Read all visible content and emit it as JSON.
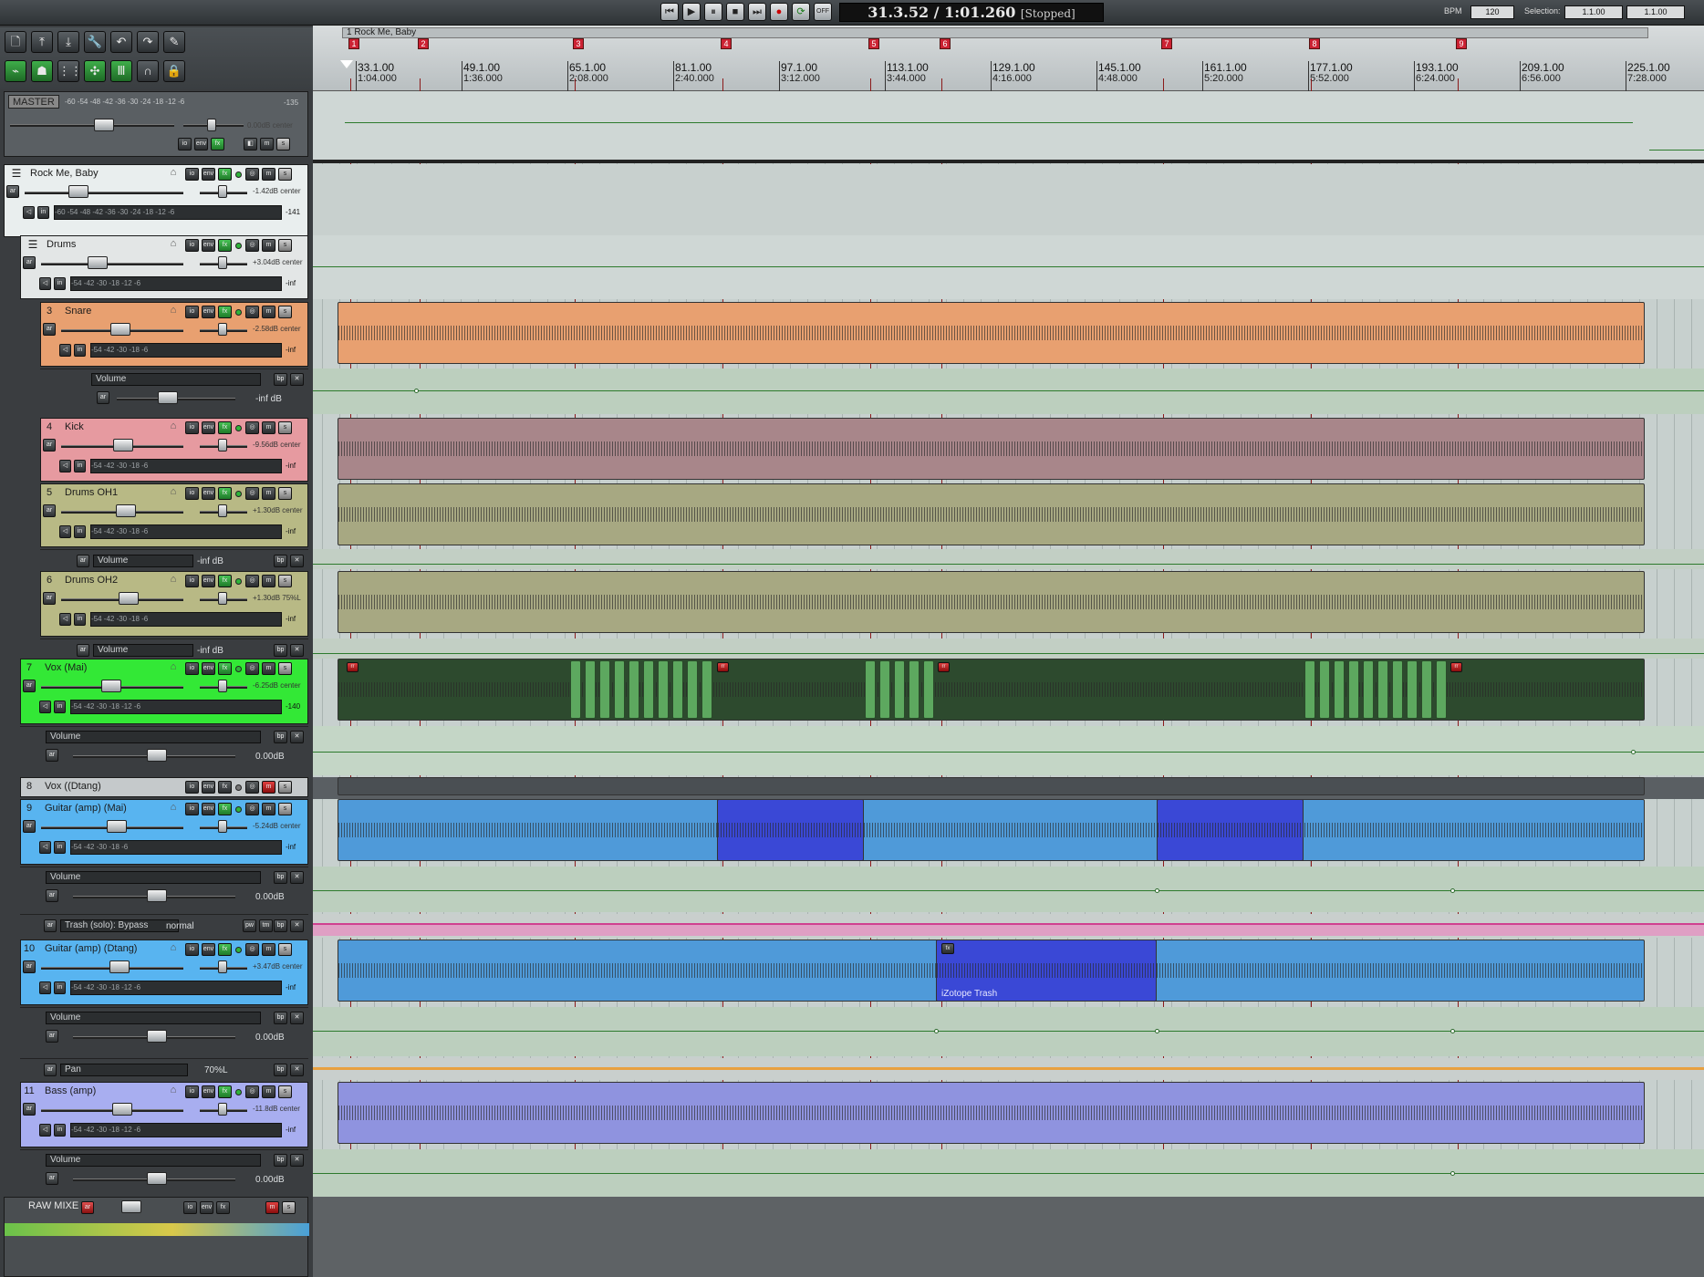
{
  "transport": {
    "time": "31.3.52 / 1:01.260",
    "state": "[Stopped]",
    "off_label": "OFF",
    "bpm_label": "BPM",
    "bpm_value": "120",
    "selection_label": "Selection:",
    "selection_start": "1.1.00",
    "selection_end": "1.1.00"
  },
  "project": {
    "region_label": "1 Rock Me, Baby"
  },
  "ruler": [
    {
      "bar": "33.1.00",
      "time": "1:04.000"
    },
    {
      "bar": "49.1.00",
      "time": "1:36.000"
    },
    {
      "bar": "65.1.00",
      "time": "2:08.000"
    },
    {
      "bar": "81.1.00",
      "time": "2:40.000"
    },
    {
      "bar": "97.1.00",
      "time": "3:12.000"
    },
    {
      "bar": "113.1.00",
      "time": "3:44.000"
    },
    {
      "bar": "129.1.00",
      "time": "4:16.000"
    },
    {
      "bar": "145.1.00",
      "time": "4:48.000"
    },
    {
      "bar": "161.1.00",
      "time": "5:20.000"
    },
    {
      "bar": "177.1.00",
      "time": "5:52.000"
    },
    {
      "bar": "193.1.00",
      "time": "6:24.000"
    },
    {
      "bar": "209.1.00",
      "time": "6:56.000"
    },
    {
      "bar": "225.1.00",
      "time": "7:28.000"
    }
  ],
  "markers": [
    "1",
    "2",
    "3",
    "4",
    "5",
    "6",
    "7",
    "8",
    "9"
  ],
  "master": {
    "label": "MASTER",
    "scale": "-60  -54  -48  -42  -36  -30  -24  -18  -12  -6",
    "peak": "-135",
    "vol": "0.00dB center"
  },
  "tracks": [
    {
      "num": "",
      "name": "Rock Me, Baby",
      "vol": "-1.42dB center",
      "meter": "-60  -54  -48  -42  -36  -30  -24  -18  -12  -6",
      "peak": "-141"
    },
    {
      "num": "",
      "name": "Drums",
      "vol": "+3.04dB center",
      "meter": "-54       -42       -30       -18   -12   -6",
      "peak": "-inf"
    },
    {
      "num": "3",
      "name": "Snare",
      "vol": "-2.58dB center",
      "meter": "-54       -42       -30       -18       -6",
      "peak": "-inf"
    },
    {
      "num": "4",
      "name": "Kick",
      "vol": "-9.56dB center",
      "meter": "-54       -42       -30       -18       -6",
      "peak": "-inf"
    },
    {
      "num": "5",
      "name": "Drums OH1",
      "vol": "+1.30dB center",
      "meter": "-54       -42       -30       -18       -6",
      "peak": "-inf"
    },
    {
      "num": "6",
      "name": "Drums OH2",
      "vol": "+1.30dB 75%L",
      "meter": "-54       -42       -30       -18       -6",
      "peak": "-inf"
    },
    {
      "num": "7",
      "name": "Vox (Mai)",
      "vol": "-6.25dB center",
      "meter": "-54       -42       -30       -18   -12   -6",
      "peak": "-140"
    },
    {
      "num": "8",
      "name": "Vox ((Dtang)",
      "vol": "",
      "meter": "",
      "peak": ""
    },
    {
      "num": "9",
      "name": "Guitar (amp) (Mai)",
      "vol": "-5.24dB center",
      "meter": "-54       -42       -30       -18       -6",
      "peak": "-inf"
    },
    {
      "num": "10",
      "name": "Guitar (amp) (Dtang)",
      "vol": "+3.47dB center",
      "meter": "-54       -42       -30       -18   -12   -6",
      "peak": "-inf"
    },
    {
      "num": "11",
      "name": "Bass (amp)",
      "vol": "-11.8dB center",
      "meter": "-54       -42       -30       -18   -12   -6",
      "peak": "-inf"
    }
  ],
  "envelopes": {
    "snare_volume": {
      "name": "Volume",
      "value": "-inf dB"
    },
    "oh1_volume": {
      "name": "Volume",
      "value": "-inf dB"
    },
    "oh2_volume": {
      "name": "Volume",
      "value": "-inf dB"
    },
    "vox_volume": {
      "name": "Volume",
      "value": "0.00dB"
    },
    "guitar_mai_volume": {
      "name": "Volume",
      "value": "0.00dB"
    },
    "trash": {
      "name": "Trash (solo): Bypass",
      "value": "normal"
    },
    "guitar_dtang_volume": {
      "name": "Volume",
      "value": "0.00dB"
    },
    "guitar_dtang_pan": {
      "name": "Pan",
      "value": "70%L"
    },
    "bass_volume": {
      "name": "Volume",
      "value": "0.00dB"
    }
  },
  "raw_mix": {
    "name": "RAW MIXE"
  },
  "take_label": "iZotope Trash",
  "buttons": {
    "io": "io",
    "env": "env",
    "fx": "fx",
    "m": "m",
    "s": "s",
    "bp": "bp",
    "x": "✕",
    "arm": "ar",
    "pw": "pw",
    "tm": "tm",
    "fx_item": "fx",
    "rec_item": "rr"
  },
  "colors": {
    "snare": "#e8a070",
    "kick": "#a8868a",
    "oh": "#a7a882",
    "vox": "#2d4a2e",
    "guitar": "#4f9ad9",
    "guitar_sel": "#3a48d6",
    "bass": "#8f93df"
  }
}
